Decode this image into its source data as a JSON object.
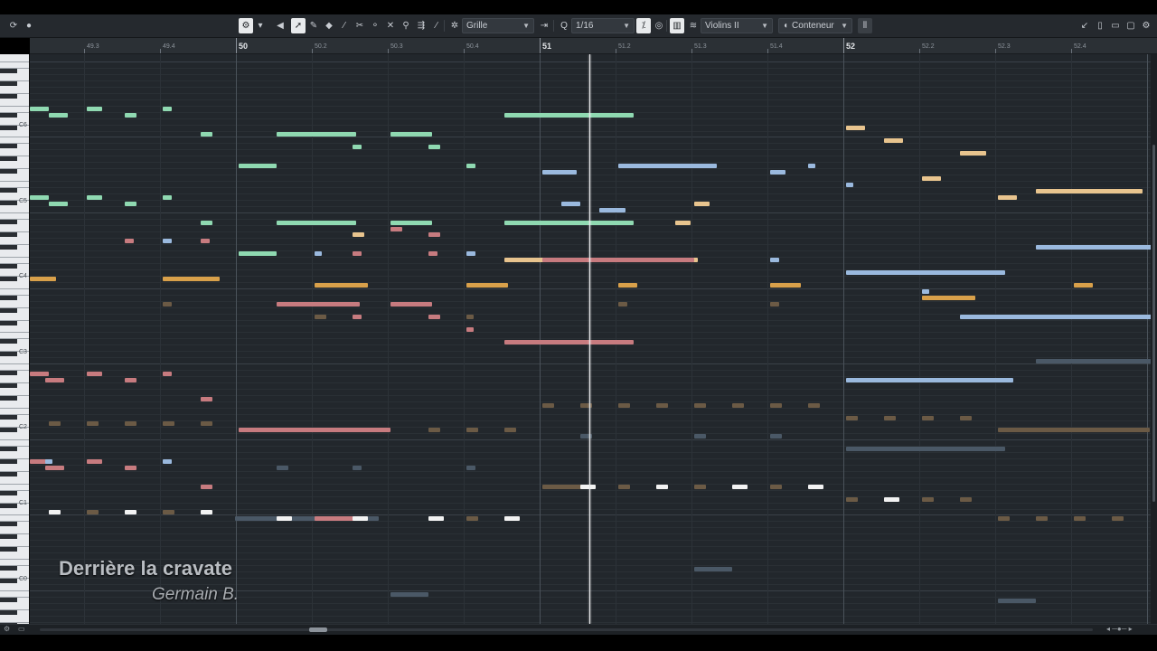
{
  "toolbar": {
    "snap_type": "Grille",
    "quantize": "1/16",
    "track": "Violins II",
    "editing_mode": "Conteneur",
    "icons": [
      "circle-arrow-icon",
      "record-dot-icon",
      "fx-icon",
      "caret-icon",
      "speaker-icon",
      "pointer-icon",
      "pencil-icon",
      "eraser-icon",
      "line-icon",
      "scissors-icon",
      "glue-icon",
      "mute-x-icon",
      "zoom-icon",
      "comp-icon",
      "draw-icon",
      "snap-icon",
      "split-icon",
      "quantize-icon",
      "chord-icon",
      "colors-icon",
      "lanes-icon",
      "edit-mode-icon",
      "velocity-icon",
      "layout-icons"
    ]
  },
  "ruler": [
    {
      "label": "49.3",
      "bar": false
    },
    {
      "label": "49.4",
      "bar": false
    },
    {
      "label": "50",
      "bar": true
    },
    {
      "label": "50.2",
      "bar": false
    },
    {
      "label": "50.3",
      "bar": false
    },
    {
      "label": "50.4",
      "bar": false
    },
    {
      "label": "51",
      "bar": true
    },
    {
      "label": "51.2",
      "bar": false
    },
    {
      "label": "51.3",
      "bar": false
    },
    {
      "label": "51.4",
      "bar": false
    },
    {
      "label": "52",
      "bar": true
    },
    {
      "label": "52.2",
      "bar": false
    },
    {
      "label": "52.3",
      "bar": false
    },
    {
      "label": "52.4",
      "bar": false
    }
  ],
  "keyboard_labels": [
    "C6",
    "C5",
    "C4",
    "C3",
    "C2",
    "C1",
    "C0"
  ],
  "overlay": {
    "title": "Derrière la cravate",
    "composer": "Germain B."
  },
  "colors": {
    "green": "#8fd9b1",
    "blue": "#9ab9de",
    "orange": "#d8a04a",
    "peach": "#e8c48e",
    "rose": "#c77b7f",
    "white": "#f2f2f2",
    "brown": "#6b5a45",
    "slate": "#4a5866"
  },
  "notes": [
    {
      "b": 0.0,
      "len": 0.25,
      "p": 76,
      "c": "green"
    },
    {
      "b": 0.25,
      "len": 0.25,
      "p": 75,
      "c": "green"
    },
    {
      "b": 0.75,
      "len": 0.2,
      "p": 76,
      "c": "green"
    },
    {
      "b": 1.25,
      "len": 0.15,
      "p": 75,
      "c": "green"
    },
    {
      "b": 1.75,
      "len": 0.12,
      "p": 76,
      "c": "green"
    },
    {
      "b": 2.25,
      "len": 0.15,
      "p": 72,
      "c": "green"
    },
    {
      "b": 3.25,
      "len": 1.05,
      "p": 72,
      "c": "green"
    },
    {
      "b": 4.25,
      "len": 0.12,
      "p": 70,
      "c": "green"
    },
    {
      "b": 4.75,
      "len": 0.55,
      "p": 72,
      "c": "green"
    },
    {
      "b": 5.25,
      "len": 0.15,
      "p": 70,
      "c": "green"
    },
    {
      "b": 2.75,
      "len": 0.5,
      "p": 67,
      "c": "green"
    },
    {
      "b": 5.75,
      "len": 0.12,
      "p": 67,
      "c": "green"
    },
    {
      "b": 6.25,
      "len": 1.7,
      "p": 75,
      "c": "green"
    },
    {
      "b": 6.75,
      "len": 0.45,
      "p": 66,
      "c": "blue"
    },
    {
      "b": 7.75,
      "len": 1.3,
      "p": 67,
      "c": "blue"
    },
    {
      "b": 9.75,
      "len": 0.2,
      "p": 66,
      "c": "blue"
    },
    {
      "b": 10.25,
      "len": 0.1,
      "p": 67,
      "c": "blue"
    },
    {
      "b": 0.0,
      "len": 0.25,
      "p": 62,
      "c": "green"
    },
    {
      "b": 0.25,
      "len": 0.25,
      "p": 61,
      "c": "green"
    },
    {
      "b": 0.75,
      "len": 0.2,
      "p": 62,
      "c": "green"
    },
    {
      "b": 1.25,
      "len": 0.15,
      "p": 61,
      "c": "green"
    },
    {
      "b": 1.75,
      "len": 0.12,
      "p": 62,
      "c": "green"
    },
    {
      "b": 2.25,
      "len": 0.15,
      "p": 58,
      "c": "green"
    },
    {
      "b": 3.25,
      "len": 1.05,
      "p": 58,
      "c": "green"
    },
    {
      "b": 4.75,
      "len": 0.55,
      "p": 58,
      "c": "green"
    },
    {
      "b": 6.25,
      "len": 1.7,
      "p": 58,
      "c": "green"
    },
    {
      "b": 2.75,
      "len": 0.5,
      "p": 53,
      "c": "green"
    },
    {
      "b": 7.0,
      "len": 0.25,
      "p": 61,
      "c": "blue"
    },
    {
      "b": 7.5,
      "len": 0.35,
      "p": 60,
      "c": "blue"
    },
    {
      "b": 8.75,
      "len": 0.2,
      "p": 61,
      "c": "peach"
    },
    {
      "b": 8.5,
      "len": 0.2,
      "p": 58,
      "c": "peach"
    },
    {
      "b": 4.25,
      "len": 0.15,
      "p": 56,
      "c": "peach"
    },
    {
      "b": 4.75,
      "len": 0.15,
      "p": 57,
      "c": "rose"
    },
    {
      "b": 5.25,
      "len": 0.15,
      "p": 56,
      "c": "rose"
    },
    {
      "b": 1.25,
      "len": 0.12,
      "p": 55,
      "c": "rose"
    },
    {
      "b": 1.75,
      "len": 0.12,
      "p": 55,
      "c": "blue"
    },
    {
      "b": 2.25,
      "len": 0.12,
      "p": 55,
      "c": "rose"
    },
    {
      "b": 3.75,
      "len": 0.1,
      "p": 53,
      "c": "blue"
    },
    {
      "b": 4.25,
      "len": 0.12,
      "p": 53,
      "c": "rose"
    },
    {
      "b": 5.25,
      "len": 0.12,
      "p": 53,
      "c": "rose"
    },
    {
      "b": 5.75,
      "len": 0.12,
      "p": 53,
      "c": "blue"
    },
    {
      "b": 6.25,
      "len": 2.55,
      "p": 52,
      "c": "peach"
    },
    {
      "b": 6.75,
      "len": 2.0,
      "p": 52,
      "c": "rose"
    },
    {
      "b": 9.75,
      "len": 0.12,
      "p": 52,
      "c": "blue"
    },
    {
      "b": 0.0,
      "len": 0.35,
      "p": 49,
      "c": "orange"
    },
    {
      "b": 1.75,
      "len": 0.75,
      "p": 49,
      "c": "orange"
    },
    {
      "b": 3.75,
      "len": 0.7,
      "p": 48,
      "c": "orange"
    },
    {
      "b": 5.75,
      "len": 0.55,
      "p": 48,
      "c": "orange"
    },
    {
      "b": 7.75,
      "len": 0.25,
      "p": 48,
      "c": "orange"
    },
    {
      "b": 9.75,
      "len": 0.4,
      "p": 48,
      "c": "orange"
    },
    {
      "b": 1.75,
      "len": 0.12,
      "p": 45,
      "c": "brown"
    },
    {
      "b": 3.25,
      "len": 1.1,
      "p": 45,
      "c": "rose"
    },
    {
      "b": 4.75,
      "len": 0.55,
      "p": 45,
      "c": "rose"
    },
    {
      "b": 3.75,
      "len": 0.15,
      "p": 43,
      "c": "brown"
    },
    {
      "b": 4.25,
      "len": 0.12,
      "p": 43,
      "c": "rose"
    },
    {
      "b": 5.25,
      "len": 0.15,
      "p": 43,
      "c": "rose"
    },
    {
      "b": 5.75,
      "len": 0.1,
      "p": 43,
      "c": "brown"
    },
    {
      "b": 7.75,
      "len": 0.12,
      "p": 45,
      "c": "brown"
    },
    {
      "b": 9.75,
      "len": 0.12,
      "p": 45,
      "c": "brown"
    },
    {
      "b": 5.75,
      "len": 0.1,
      "p": 41,
      "c": "rose"
    },
    {
      "b": 6.25,
      "len": 1.7,
      "p": 39,
      "c": "rose"
    },
    {
      "b": 10.75,
      "len": 2.1,
      "p": 50,
      "c": "blue"
    },
    {
      "b": 11.75,
      "len": 0.1,
      "p": 47,
      "c": "blue"
    },
    {
      "b": 11.75,
      "len": 0.7,
      "p": 46,
      "c": "orange"
    },
    {
      "b": 12.25,
      "len": 3.5,
      "p": 43,
      "c": "blue"
    },
    {
      "b": 12.25,
      "len": 0.35,
      "p": 69,
      "c": "peach"
    },
    {
      "b": 10.75,
      "len": 0.25,
      "p": 73,
      "c": "peach"
    },
    {
      "b": 11.25,
      "len": 0.25,
      "p": 71,
      "c": "peach"
    },
    {
      "b": 11.75,
      "len": 0.25,
      "p": 65,
      "c": "peach"
    },
    {
      "b": 12.75,
      "len": 0.25,
      "p": 62,
      "c": "peach"
    },
    {
      "b": 13.25,
      "len": 1.4,
      "p": 63,
      "c": "peach"
    },
    {
      "b": 10.75,
      "len": 0.1,
      "p": 64,
      "c": "blue"
    },
    {
      "b": 13.25,
      "len": 2.0,
      "p": 54,
      "c": "blue"
    },
    {
      "b": 13.75,
      "len": 0.25,
      "p": 48,
      "c": "orange"
    },
    {
      "b": 13.25,
      "len": 2.0,
      "p": 36,
      "c": "slate"
    },
    {
      "b": 10.75,
      "len": 2.2,
      "p": 33,
      "c": "blue"
    },
    {
      "b": 0.0,
      "len": 0.25,
      "p": 34,
      "c": "rose"
    },
    {
      "b": 0.2,
      "len": 0.25,
      "p": 33,
      "c": "rose"
    },
    {
      "b": 0.75,
      "len": 0.2,
      "p": 34,
      "c": "rose"
    },
    {
      "b": 1.25,
      "len": 0.15,
      "p": 33,
      "c": "rose"
    },
    {
      "b": 1.75,
      "len": 0.12,
      "p": 34,
      "c": "rose"
    },
    {
      "b": 2.25,
      "len": 0.15,
      "p": 30,
      "c": "rose"
    },
    {
      "b": 0.25,
      "len": 0.15,
      "p": 26,
      "c": "brown"
    },
    {
      "b": 0.75,
      "len": 0.15,
      "p": 26,
      "c": "brown"
    },
    {
      "b": 1.25,
      "len": 0.15,
      "p": 26,
      "c": "brown"
    },
    {
      "b": 1.75,
      "len": 0.15,
      "p": 26,
      "c": "brown"
    },
    {
      "b": 2.25,
      "len": 0.15,
      "p": 26,
      "c": "brown"
    },
    {
      "b": 2.75,
      "len": 2.0,
      "p": 25,
      "c": "rose"
    },
    {
      "b": 5.25,
      "len": 0.15,
      "p": 25,
      "c": "brown"
    },
    {
      "b": 5.75,
      "len": 0.15,
      "p": 25,
      "c": "brown"
    },
    {
      "b": 6.25,
      "len": 0.15,
      "p": 25,
      "c": "brown"
    },
    {
      "b": 6.75,
      "len": 0.15,
      "p": 29,
      "c": "brown"
    },
    {
      "b": 7.25,
      "len": 0.15,
      "p": 29,
      "c": "brown"
    },
    {
      "b": 7.75,
      "len": 0.15,
      "p": 29,
      "c": "brown"
    },
    {
      "b": 8.25,
      "len": 0.15,
      "p": 29,
      "c": "brown"
    },
    {
      "b": 8.75,
      "len": 0.15,
      "p": 29,
      "c": "brown"
    },
    {
      "b": 9.25,
      "len": 0.15,
      "p": 29,
      "c": "brown"
    },
    {
      "b": 9.75,
      "len": 0.15,
      "p": 29,
      "c": "brown"
    },
    {
      "b": 10.25,
      "len": 0.15,
      "p": 29,
      "c": "brown"
    },
    {
      "b": 10.75,
      "len": 0.15,
      "p": 27,
      "c": "brown"
    },
    {
      "b": 11.25,
      "len": 0.15,
      "p": 27,
      "c": "brown"
    },
    {
      "b": 11.75,
      "len": 0.15,
      "p": 27,
      "c": "brown"
    },
    {
      "b": 12.25,
      "len": 0.15,
      "p": 27,
      "c": "brown"
    },
    {
      "b": 7.25,
      "len": 0.15,
      "p": 24,
      "c": "slate"
    },
    {
      "b": 8.75,
      "len": 0.15,
      "p": 24,
      "c": "slate"
    },
    {
      "b": 9.75,
      "len": 0.15,
      "p": 24,
      "c": "slate"
    },
    {
      "b": 10.75,
      "len": 2.1,
      "p": 22,
      "c": "slate"
    },
    {
      "b": 12.75,
      "len": 2.0,
      "p": 25,
      "c": "brown"
    },
    {
      "b": 0.0,
      "len": 0.25,
      "p": 20,
      "c": "rose"
    },
    {
      "b": 0.2,
      "len": 0.1,
      "p": 20,
      "c": "blue"
    },
    {
      "b": 0.2,
      "len": 0.25,
      "p": 19,
      "c": "rose"
    },
    {
      "b": 0.75,
      "len": 0.2,
      "p": 20,
      "c": "rose"
    },
    {
      "b": 1.25,
      "len": 0.15,
      "p": 19,
      "c": "rose"
    },
    {
      "b": 1.75,
      "len": 0.12,
      "p": 20,
      "c": "blue"
    },
    {
      "b": 2.25,
      "len": 0.15,
      "p": 16,
      "c": "rose"
    },
    {
      "b": 3.25,
      "len": 0.15,
      "p": 19,
      "c": "slate"
    },
    {
      "b": 4.25,
      "len": 0.12,
      "p": 19,
      "c": "slate"
    },
    {
      "b": 5.75,
      "len": 0.12,
      "p": 19,
      "c": "slate"
    },
    {
      "b": 6.75,
      "len": 0.55,
      "p": 16,
      "c": "brown"
    },
    {
      "b": 7.25,
      "len": 0.2,
      "p": 16,
      "c": "white"
    },
    {
      "b": 7.75,
      "len": 0.15,
      "p": 16,
      "c": "brown"
    },
    {
      "b": 8.25,
      "len": 0.15,
      "p": 16,
      "c": "white"
    },
    {
      "b": 8.75,
      "len": 0.15,
      "p": 16,
      "c": "brown"
    },
    {
      "b": 9.25,
      "len": 0.2,
      "p": 16,
      "c": "white"
    },
    {
      "b": 9.75,
      "len": 0.15,
      "p": 16,
      "c": "brown"
    },
    {
      "b": 10.25,
      "len": 0.2,
      "p": 16,
      "c": "white"
    },
    {
      "b": 10.75,
      "len": 0.15,
      "p": 14,
      "c": "brown"
    },
    {
      "b": 11.25,
      "len": 0.2,
      "p": 14,
      "c": "white"
    },
    {
      "b": 11.75,
      "len": 0.15,
      "p": 14,
      "c": "brown"
    },
    {
      "b": 12.25,
      "len": 0.15,
      "p": 14,
      "c": "brown"
    },
    {
      "b": 0.25,
      "len": 0.15,
      "p": 12,
      "c": "white"
    },
    {
      "b": 0.75,
      "len": 0.15,
      "p": 12,
      "c": "brown"
    },
    {
      "b": 1.25,
      "len": 0.15,
      "p": 12,
      "c": "white"
    },
    {
      "b": 1.75,
      "len": 0.15,
      "p": 12,
      "c": "brown"
    },
    {
      "b": 2.25,
      "len": 0.15,
      "p": 12,
      "c": "white"
    },
    {
      "b": 2.7,
      "len": 1.9,
      "p": 11,
      "c": "slate"
    },
    {
      "b": 3.25,
      "len": 0.2,
      "p": 11,
      "c": "white"
    },
    {
      "b": 3.75,
      "len": 0.6,
      "p": 11,
      "c": "rose"
    },
    {
      "b": 4.25,
      "len": 0.2,
      "p": 11,
      "c": "white"
    },
    {
      "b": 5.25,
      "len": 0.2,
      "p": 11,
      "c": "white"
    },
    {
      "b": 5.75,
      "len": 0.15,
      "p": 11,
      "c": "brown"
    },
    {
      "b": 6.25,
      "len": 0.2,
      "p": 11,
      "c": "white"
    },
    {
      "b": 12.75,
      "len": 0.15,
      "p": 11,
      "c": "brown"
    },
    {
      "b": 13.25,
      "len": 0.15,
      "p": 11,
      "c": "brown"
    },
    {
      "b": 13.75,
      "len": 0.15,
      "p": 11,
      "c": "brown"
    },
    {
      "b": 14.25,
      "len": 0.15,
      "p": 11,
      "c": "brown"
    },
    {
      "b": 8.75,
      "len": 0.5,
      "p": 3,
      "c": "slate"
    },
    {
      "b": 4.75,
      "len": 0.5,
      "p": -1,
      "c": "slate"
    },
    {
      "b": 12.75,
      "len": 0.5,
      "p": -2,
      "c": "slate"
    }
  ]
}
